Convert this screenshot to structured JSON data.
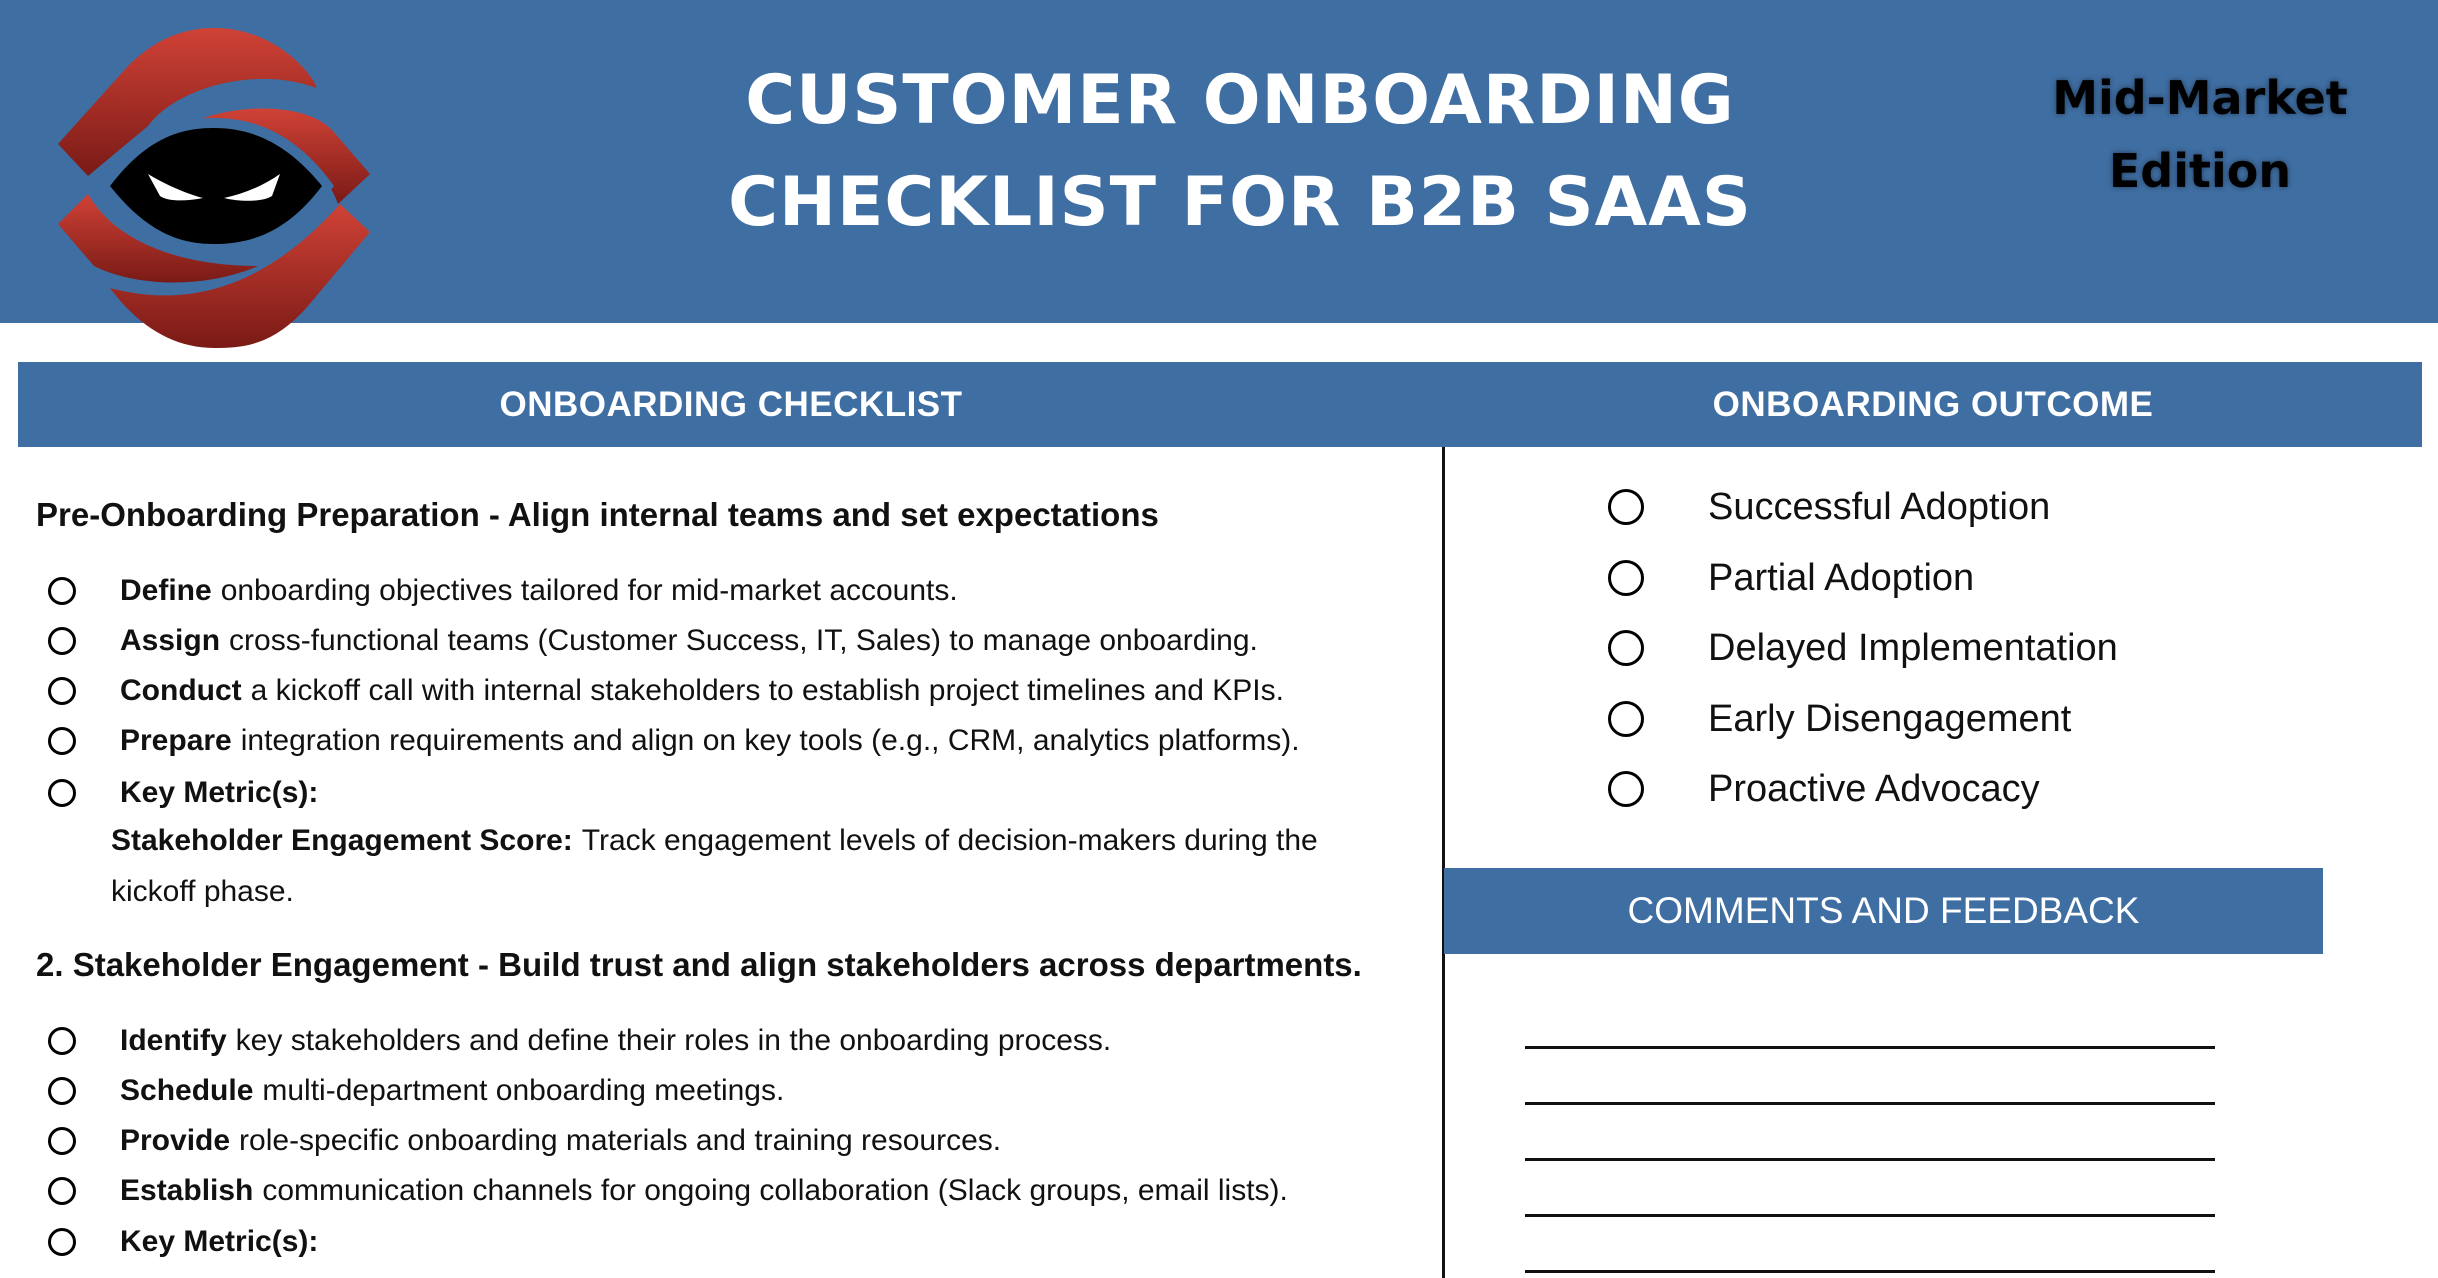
{
  "header": {
    "title_line1": "CUSTOMER ONBOARDING",
    "title_line2": "CHECKLIST FOR B2B SAAS",
    "edition_line1": "Mid-Market",
    "edition_line2": "Edition",
    "brand_color": "#3F6EA2",
    "logo_icon": "ninja-eye-logo-icon"
  },
  "sections": {
    "checklist_title": "ONBOARDING CHECKLIST",
    "outcome_title": "ONBOARDING OUTCOME",
    "comments_title": "COMMENTS AND FEEDBACK"
  },
  "checklist": [
    {
      "heading": "Pre-Onboarding Preparation - Align internal teams and set expectations",
      "items": [
        {
          "verb": "Define",
          "text": "onboarding objectives tailored for mid-market accounts."
        },
        {
          "verb": "Assign",
          "text": "cross-functional teams (Customer Success, IT, Sales) to manage onboarding."
        },
        {
          "verb": "Conduct",
          "text": "a kickoff call with internal stakeholders to establish project timelines and KPIs."
        },
        {
          "verb": "Prepare",
          "text": "integration requirements and align on key tools (e.g., CRM, analytics platforms)."
        },
        {
          "verb": "Key Metric(s):",
          "text": ""
        }
      ],
      "metric_label": "Stakeholder Engagement Score:",
      "metric_text_line1": "Track engagement levels of decision-makers during the",
      "metric_text_line2": "kickoff phase."
    },
    {
      "heading": "2. Stakeholder Engagement - Build trust and align stakeholders across departments.",
      "items": [
        {
          "verb": "Identify",
          "text": "key stakeholders and define their roles in the onboarding process."
        },
        {
          "verb": "Schedule",
          "text": "multi-department onboarding meetings."
        },
        {
          "verb": "Provide",
          "text": "role-specific onboarding materials and training resources."
        },
        {
          "verb": "Establish",
          "text": "communication channels for ongoing collaboration (Slack groups, email lists)."
        },
        {
          "verb": "Key Metric(s):",
          "text": ""
        }
      ]
    }
  ],
  "outcomes": [
    "Successful Adoption",
    "Partial Adoption",
    "Delayed Implementation",
    "Early Disengagement",
    "Proactive Advocacy"
  ],
  "comments": {
    "line_count": 5
  }
}
